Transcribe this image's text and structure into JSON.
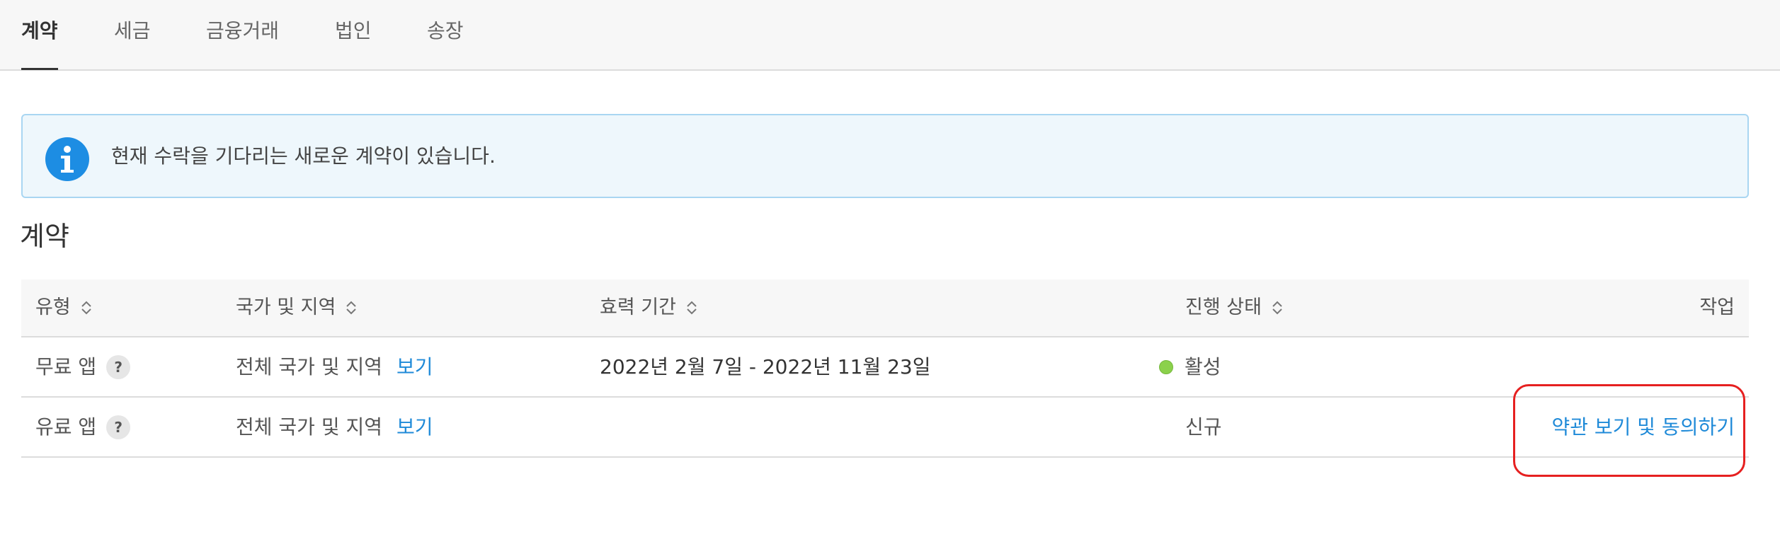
{
  "tabs": [
    {
      "label": "계약",
      "active": true
    },
    {
      "label": "세금",
      "active": false
    },
    {
      "label": "금융거래",
      "active": false
    },
    {
      "label": "법인",
      "active": false
    },
    {
      "label": "송장",
      "active": false
    }
  ],
  "alert": {
    "icon": "info-icon",
    "text": "현재 수락을 기다리는 새로운 계약이 있습니다.",
    "color": "#1d8de3"
  },
  "section": {
    "title": "계약"
  },
  "table": {
    "headers": {
      "type": "유형",
      "region": "국가 및 지역",
      "period": "효력 기간",
      "status": "진행 상태",
      "action": "작업"
    },
    "rows": [
      {
        "type": "무료 앱",
        "help": "?",
        "region": "전체 국가 및 지역",
        "region_link": "보기",
        "period": "2022년 2월 7일 - 2022년 11월 23일",
        "status": "활성",
        "status_color": "#8bd14b",
        "action": ""
      },
      {
        "type": "유료 앱",
        "help": "?",
        "region": "전체 국가 및 지역",
        "region_link": "보기",
        "period": "",
        "status": "신규",
        "action": "약관 보기 및 동의하기"
      }
    ]
  },
  "colors": {
    "link": "#1f8ad8",
    "highlight": "#e62020"
  }
}
